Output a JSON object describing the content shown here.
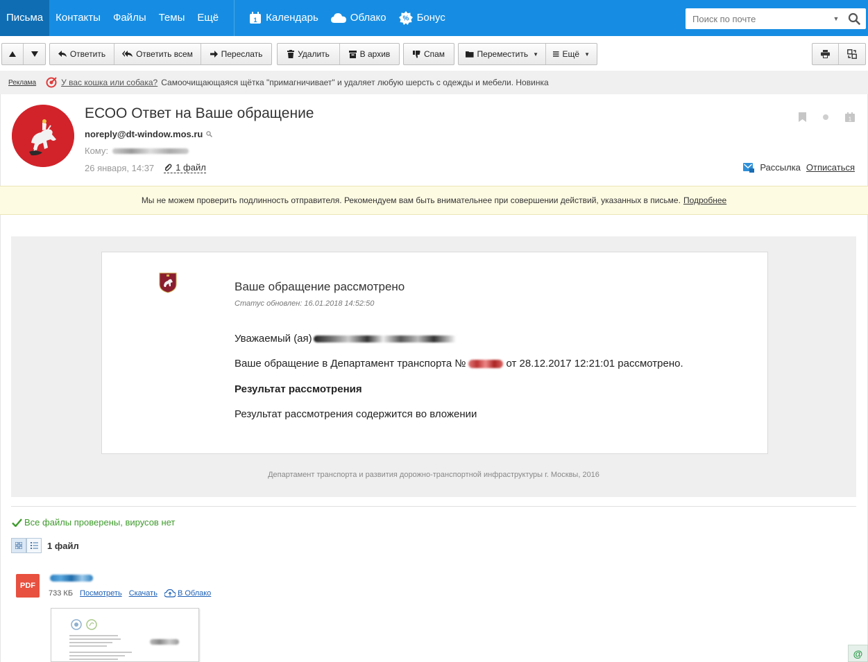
{
  "nav": {
    "items": [
      {
        "label": "Письма",
        "active": true
      },
      {
        "label": "Контакты"
      },
      {
        "label": "Файлы"
      },
      {
        "label": "Темы"
      },
      {
        "label": "Ещё"
      }
    ],
    "services": [
      {
        "label": "Календарь",
        "icon": "calendar-icon"
      },
      {
        "label": "Облако",
        "icon": "cloud-icon"
      },
      {
        "label": "Бонус",
        "icon": "bonus-icon"
      }
    ],
    "search_placeholder": "Поиск по почте",
    "accent_color": "#168de2"
  },
  "toolbar": {
    "reply": "Ответить",
    "reply_all": "Ответить всем",
    "forward": "Переслать",
    "delete": "Удалить",
    "archive": "В архив",
    "spam": "Спам",
    "move": "Переместить",
    "more": "Ещё"
  },
  "ad": {
    "label": "Реклама",
    "link": "У вас кошка или собака?",
    "text": "Самоочищающаяся щётка \"примагничивает\" и удаляет любую шерсть с одежды и мебели. Новинка"
  },
  "message": {
    "subject": "ЕСОО Ответ на Ваше обращение",
    "sender": "noreply@dt-window.mos.ru",
    "to_label": "Кому:",
    "date": "26 января, 14:37",
    "files_link": "1 файл",
    "newsletter_label": "Рассылка",
    "unsubscribe": "Отписаться"
  },
  "warning": {
    "text": "Мы не можем проверить подлинность отправителя. Рекомендуем вам быть внимательнее при совершении действий, указанных в письме.",
    "more": "Подробнее"
  },
  "body": {
    "title": "Ваше обращение рассмотрено",
    "status": "Статус обновлен: 16.01.2018 14:52:50",
    "greeting": "Уважаемый (ая)",
    "line1_start": "Ваше обращение в Департамент транспорта №",
    "line1_end": "от 28.12.2017 12:21:01 рассмотрено.",
    "result_heading": "Результат рассмотрения",
    "result_text": "Результат рассмотрения содержится во вложении",
    "footer": "Департамент транспорта и развития дорожно-транспортной инфраструктуры г. Москвы, 2016"
  },
  "attachments": {
    "virus_check": "Все файлы проверены, вирусов нет",
    "count_label": "1 файл",
    "file_type": "PDF",
    "size": "733 КБ",
    "view": "Посмотреть",
    "download": "Скачать",
    "to_cloud": "В Облако"
  }
}
